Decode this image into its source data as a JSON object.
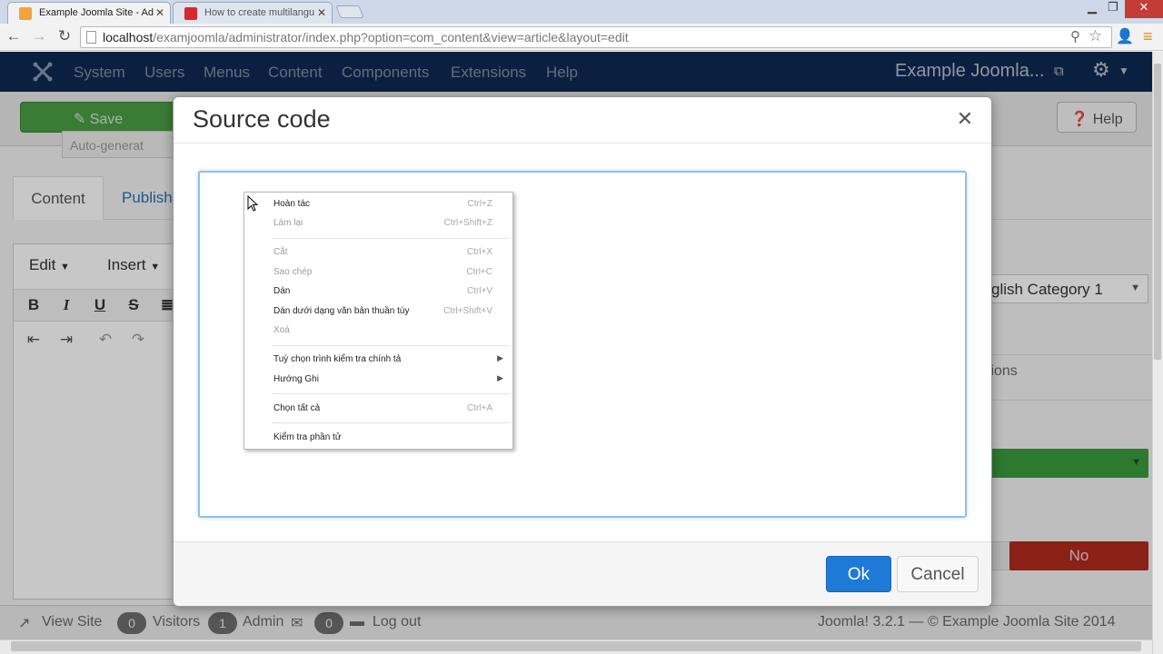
{
  "browser": {
    "tabs": [
      {
        "title": "Example Joomla Site - Ad",
        "active": true
      },
      {
        "title": "How to create multilangu",
        "active": false
      }
    ],
    "url_host": "localhost",
    "url_path": "/examjoomla/administrator/index.php?option=com_content&view=article&layout=edit"
  },
  "admin_nav": {
    "items": [
      "System",
      "Users",
      "Menus",
      "Content",
      "Components",
      "Extensions",
      "Help"
    ],
    "site_name": "Example Joomla..."
  },
  "toolbar": {
    "save_label": "Save",
    "help_label": "Help"
  },
  "alias_field": {
    "value": "Auto-generat"
  },
  "article_tabs": {
    "content": "Content",
    "publishing": "Publish"
  },
  "editor": {
    "menu_edit": "Edit",
    "menu_insert": "Insert"
  },
  "right_panel": {
    "category": "glish Category 1",
    "options_label": "tions",
    "no_label": "No"
  },
  "modal": {
    "title": "Source code",
    "ok_label": "Ok",
    "cancel_label": "Cancel"
  },
  "context_menu": {
    "items": [
      {
        "label": "Hoàn tác",
        "shortcut": "Ctrl+Z",
        "enabled": true
      },
      {
        "label": "Làm lại",
        "shortcut": "Ctrl+Shift+Z",
        "enabled": false
      },
      {
        "label": "Cắt",
        "shortcut": "Ctrl+X",
        "enabled": false
      },
      {
        "label": "Sao chép",
        "shortcut": "Ctrl+C",
        "enabled": false
      },
      {
        "label": "Dán",
        "shortcut": "Ctrl+V",
        "enabled": true
      },
      {
        "label": "Dán dưới dạng văn bản thuần túy",
        "shortcut": "Ctrl+Shift+V",
        "enabled": true
      },
      {
        "label": "Xoá",
        "shortcut": "",
        "enabled": false
      },
      {
        "label": "Tuỳ chọn trình kiểm tra chính tả",
        "shortcut": "",
        "enabled": true
      },
      {
        "label": "Hướng Ghi",
        "shortcut": "",
        "enabled": true
      },
      {
        "label": "Chọn tất cả",
        "shortcut": "Ctrl+A",
        "enabled": true
      },
      {
        "label": "Kiểm tra phần tử",
        "shortcut": "",
        "enabled": true
      }
    ]
  },
  "status_bar": {
    "view_site": "View Site",
    "visitors_count": "0",
    "visitors_label": "Visitors",
    "admin_count": "1",
    "admin_label": "Admin",
    "messages_count": "0",
    "logout_label": "Log out",
    "footer": "Joomla! 3.2.1 — © Example Joomla Site 2014"
  },
  "colors": {
    "nav_bg": "#0f2a52",
    "save_green": "#4b9e46",
    "ok_blue": "#1e7ad6",
    "no_red": "#b22a1e"
  }
}
